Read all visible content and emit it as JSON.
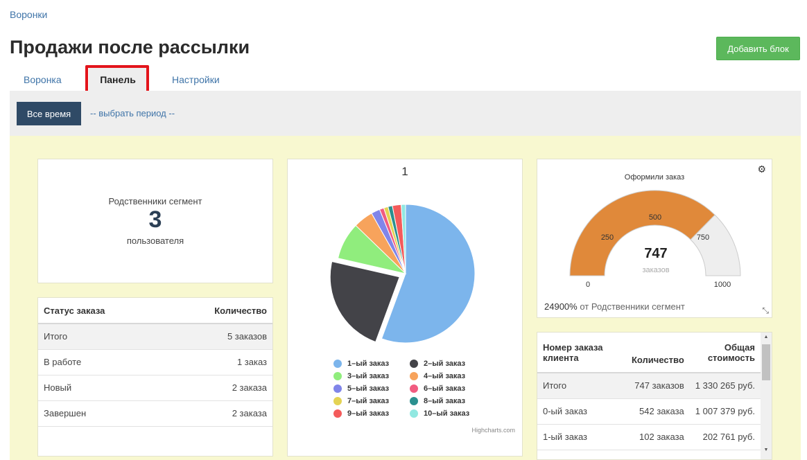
{
  "breadcrumb": "Воронки",
  "page_title": "Продажи после рассылки",
  "add_block_label": "Добавить блок",
  "tabs": [
    {
      "label": "Воронка"
    },
    {
      "label": "Панель"
    },
    {
      "label": "Настройки"
    }
  ],
  "filter": {
    "all_time_label": "Все время",
    "period_link": "-- выбрать период --"
  },
  "segment_card": {
    "name": "Родственники сегмент",
    "count": "3",
    "unit": "пользователя"
  },
  "status_table": {
    "headers": [
      "Статус заказа",
      "Количество"
    ],
    "rows": [
      [
        "Итого",
        "5 заказов"
      ],
      [
        "В работе",
        "1 заказ"
      ],
      [
        "Новый",
        "2 заказа"
      ],
      [
        "Завершен",
        "2 заказа"
      ]
    ]
  },
  "pie_card": {
    "title": "1",
    "credits": "Highcharts.com",
    "legend": [
      {
        "label": "1–ый заказ",
        "color": "#7cb5ec"
      },
      {
        "label": "2–ый заказ",
        "color": "#434348"
      },
      {
        "label": "3–ый заказ",
        "color": "#90ed7d"
      },
      {
        "label": "4–ый заказ",
        "color": "#f7a35c"
      },
      {
        "label": "5–ый заказ",
        "color": "#8085e9"
      },
      {
        "label": "6–ый заказ",
        "color": "#f15c80"
      },
      {
        "label": "7–ый заказ",
        "color": "#e4d354"
      },
      {
        "label": "8–ый заказ",
        "color": "#2b908f"
      },
      {
        "label": "9–ый заказ",
        "color": "#f45b5b"
      },
      {
        "label": "10–ый заказ",
        "color": "#91e8e1"
      }
    ]
  },
  "chart_data": [
    {
      "type": "pie",
      "title": "1",
      "categories": [
        "1–ый заказ",
        "2–ый заказ",
        "3–ый заказ",
        "4–ый заказ",
        "5–ый заказ",
        "6–ый заказ",
        "7–ый заказ",
        "8–ый заказ",
        "9–ый заказ",
        "10–ый заказ"
      ],
      "values": [
        54.5,
        22.5,
        8.5,
        4.5,
        2.0,
        1.0,
        1.0,
        1.0,
        2.0,
        1.0
      ],
      "colors": [
        "#7cb5ec",
        "#434348",
        "#90ed7d",
        "#f7a35c",
        "#8085e9",
        "#f15c80",
        "#e4d354",
        "#2b908f",
        "#f45b5b",
        "#91e8e1"
      ],
      "sliced": 1,
      "legend": "bottom"
    },
    {
      "type": "gauge",
      "title": "Оформили заказ",
      "value": 747,
      "value_label": "747",
      "unit": "заказов",
      "min": 0,
      "max": 1000,
      "ticks": [
        0,
        250,
        500,
        750,
        1000
      ],
      "fill_color": "#e0893a",
      "track_color": "#eeeeee"
    }
  ],
  "gauge_card": {
    "title": "Оформили заказ",
    "value": "747",
    "unit": "заказов",
    "tick_labels": [
      "0",
      "250",
      "500",
      "750",
      "1000"
    ],
    "footer_percent": "24900%",
    "footer_text": " от Родственники сегмент"
  },
  "orders_table": {
    "headers": [
      "Номер заказа клиента",
      "Количество",
      "Общая стоимость"
    ],
    "rows": [
      [
        "Итого",
        "747 заказов",
        "1 330 265 руб."
      ],
      [
        "0-ый заказ",
        "542 заказа",
        "1 007 379 руб."
      ],
      [
        "1-ый заказ",
        "102 заказа",
        "202 761 руб."
      ]
    ]
  }
}
